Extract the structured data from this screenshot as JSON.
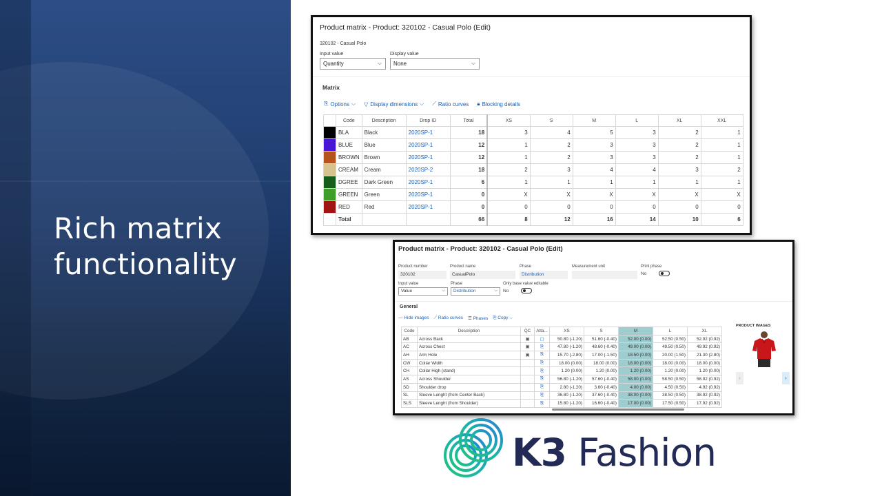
{
  "slide": {
    "headline_line1": "Rich matrix",
    "headline_line2": "functionality"
  },
  "window1": {
    "title": "Product matrix - Product: 320102 - Casual Polo (Edit)",
    "subtitle": "320102 - Casual Polo",
    "input_value_label": "Input value",
    "input_value": "Quantity",
    "display_value_label": "Display value",
    "display_value": "None",
    "section_label": "Matrix",
    "toolbar": {
      "options": "Options",
      "display_dimensions": "Display dimensions",
      "ratio_curves": "Ratio curves",
      "blocking_details": "Blocking details"
    },
    "headers": [
      "Code",
      "Description",
      "Drop ID",
      "Total",
      "XS",
      "S",
      "M",
      "L",
      "XL",
      "XXL"
    ],
    "rows": [
      {
        "color": "#000000",
        "code": "BLA",
        "description": "Black",
        "drop": "2020SP-1",
        "total": "18",
        "sizes": [
          "3",
          "4",
          "5",
          "3",
          "2",
          "1"
        ]
      },
      {
        "color": "#4a16d6",
        "code": "BLUE",
        "description": "Blue",
        "drop": "2020SP-1",
        "total": "12",
        "sizes": [
          "1",
          "2",
          "3",
          "3",
          "2",
          "1"
        ]
      },
      {
        "color": "#b5531d",
        "code": "BROWN",
        "description": "Brown",
        "drop": "2020SP-1",
        "total": "12",
        "sizes": [
          "1",
          "2",
          "3",
          "3",
          "2",
          "1"
        ]
      },
      {
        "color": "#d7c38f",
        "code": "CREAM",
        "description": "Cream",
        "drop": "2020SP-2",
        "total": "18",
        "sizes": [
          "2",
          "3",
          "4",
          "4",
          "3",
          "2"
        ]
      },
      {
        "color": "#165c1a",
        "code": "DGREE",
        "description": "Dark Green",
        "drop": "2020SP-1",
        "total": "6",
        "sizes": [
          "1",
          "1",
          "1",
          "1",
          "1",
          "1"
        ]
      },
      {
        "color": "#3e9e2a",
        "code": "GREEN",
        "description": "Green",
        "drop": "2020SP-1",
        "total": "0",
        "sizes": [
          "X",
          "X",
          "X",
          "X",
          "X",
          "X"
        ]
      },
      {
        "color": "#a01414",
        "code": "RED",
        "description": "Red",
        "drop": "2020SP-1",
        "total": "0",
        "sizes": [
          "0",
          "0",
          "0",
          "0",
          "0",
          "0"
        ]
      }
    ],
    "totals": {
      "label": "Total",
      "total": "66",
      "sizes": [
        "8",
        "12",
        "16",
        "14",
        "10",
        "6"
      ]
    }
  },
  "window2": {
    "title": "Product matrix - Product: 320102 - Casual Polo (Edit)",
    "product_number_label": "Product number",
    "product_number": "320102",
    "product_name_label": "Product name",
    "product_name": "CasualPolo",
    "phase_label": "Phase",
    "phase": "Distribution",
    "measurement_unit_label": "Measurement unit",
    "measurement_unit": "",
    "print_phase_label": "Print phase",
    "print_phase": "No",
    "input_value_label": "Input value",
    "input_value": "Value",
    "phase2_label": "Phase",
    "phase2": "Distribution",
    "base_editable_label": "Only base value editable",
    "base_editable": "No",
    "section_label": "General",
    "toolbar": {
      "hide_images": "Hide images",
      "ratio_curves": "Ratio curves",
      "phases": "Phases",
      "copy": "Copy"
    },
    "headers": [
      "Code",
      "Description",
      "QC",
      "Atta...",
      "XS",
      "S",
      "M",
      "L",
      "XL"
    ],
    "rows": [
      {
        "code": "AB",
        "description": "Across Back",
        "qc": "▣",
        "att": "▢",
        "sizes": [
          "50.80 (-1.20)",
          "51.60 (-0.40)",
          "52.00 (0.00)",
          "52.50 (0.50)",
          "52.92 (0.92)"
        ]
      },
      {
        "code": "AC",
        "description": "Across Chest",
        "qc": "▣",
        "att": "⎘",
        "sizes": [
          "47.80 (-1.20)",
          "48.60 (-0.40)",
          "49.00 (0.00)",
          "49.50 (0.50)",
          "49.92 (0.92)"
        ]
      },
      {
        "code": "AH",
        "description": "Arm Hole",
        "qc": "▣",
        "att": "⎘",
        "sizes": [
          "15.70 (-2.80)",
          "17.00 (-1.50)",
          "18.50 (0.00)",
          "20.00 (1.50)",
          "21.30 (2.80)"
        ]
      },
      {
        "code": "CW",
        "description": "Collar Width",
        "qc": "",
        "att": "⎘",
        "sizes": [
          "18.00 (0.00)",
          "18.00 (0.00)",
          "18.00 (0.00)",
          "18.00 (0.00)",
          "18.00 (0.00)"
        ]
      },
      {
        "code": "CH",
        "description": "Collar High (stand)",
        "qc": "",
        "att": "⎘",
        "sizes": [
          "1.20 (0.00)",
          "1.20 (0.00)",
          "1.20 (0.00)",
          "1.20 (0.00)",
          "1.20 (0.00)"
        ]
      },
      {
        "code": "AS",
        "description": "Across Shoulder",
        "qc": "",
        "att": "⎘",
        "sizes": [
          "56.80 (-1.20)",
          "57.60 (-0.40)",
          "58.00 (0.00)",
          "58.50 (0.50)",
          "58.92 (0.92)"
        ]
      },
      {
        "code": "SD",
        "description": "Shoulder drop",
        "qc": "",
        "att": "⎘",
        "sizes": [
          "2.80 (-1.20)",
          "3.60 (-0.40)",
          "4.00 (0.00)",
          "4.50 (0.50)",
          "4.92 (0.92)"
        ]
      },
      {
        "code": "SL",
        "description": "Sleeve Lenght (from Center Back)",
        "qc": "",
        "att": "⎘",
        "sizes": [
          "36.80 (-1.20)",
          "37.60 (-0.40)",
          "38.00 (0.00)",
          "38.50 (0.50)",
          "38.92 (0.92)"
        ]
      },
      {
        "code": "SLS",
        "description": "Sleeve Lenght (from Shoulder)",
        "qc": "",
        "att": "⎘",
        "sizes": [
          "15.80 (-1.20)",
          "16.60 (-0.40)",
          "17.00 (0.00)",
          "17.50 (0.50)",
          "17.92 (0.92)"
        ]
      }
    ],
    "product_images_label": "PRODUCT IMAGES",
    "prev": "‹",
    "next": "›"
  },
  "logo": {
    "brand_bold": "K3",
    "brand_rest": " Fashion"
  },
  "colors": {
    "panel": "#1e3a6a",
    "link": "#1a5fb4",
    "highlight": "#9fcccf",
    "logo_text": "#232a55"
  }
}
